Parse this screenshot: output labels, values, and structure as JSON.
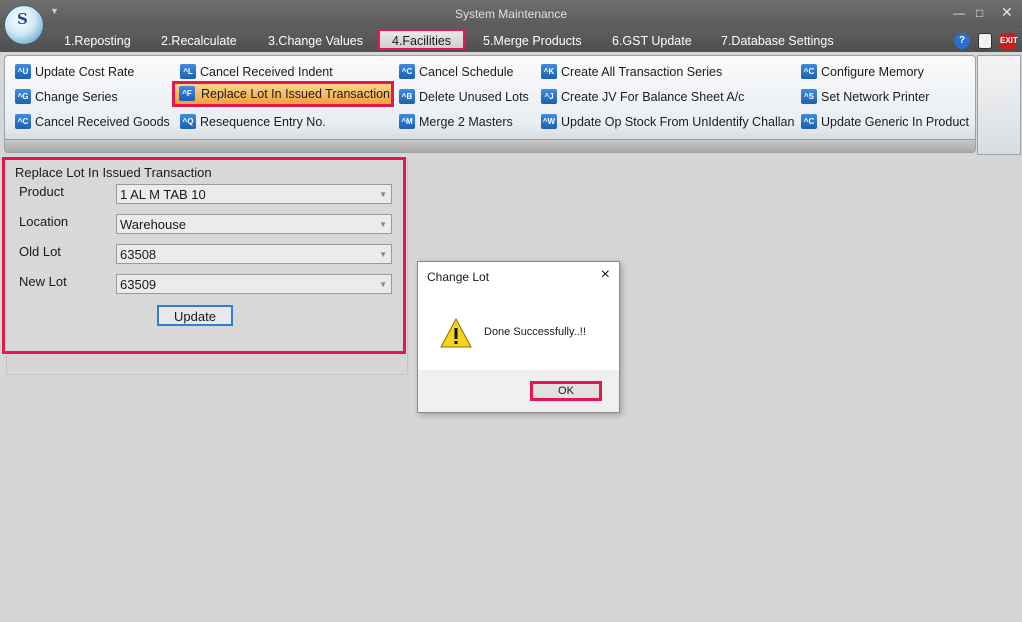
{
  "window": {
    "title": "System Maintenance"
  },
  "menu": {
    "items": [
      {
        "label": "1.Reposting"
      },
      {
        "label": "2.Recalculate"
      },
      {
        "label": "3.Change Values"
      },
      {
        "label": "4.Facilities"
      },
      {
        "label": "5.Merge Products"
      },
      {
        "label": "6.GST Update"
      },
      {
        "label": "7.Database Settings"
      }
    ],
    "active": "4.Facilities"
  },
  "ribbon": {
    "items": [
      {
        "label": "Update Cost Rate",
        "icon": "^U"
      },
      {
        "label": "Change Series",
        "icon": "^G"
      },
      {
        "label": "Cancel Received Goods",
        "icon": "^C"
      },
      {
        "label": "Cancel Received Indent",
        "icon": "^L"
      },
      {
        "label": "Replace Lot In Issued Transaction",
        "icon": "^F"
      },
      {
        "label": "Resequence Entry No.",
        "icon": "^Q"
      },
      {
        "label": "Cancel Schedule",
        "icon": "^C"
      },
      {
        "label": "Delete Unused Lots",
        "icon": "^B"
      },
      {
        "label": "Merge 2 Masters",
        "icon": "^M"
      },
      {
        "label": "Create All Transaction Series",
        "icon": "^K"
      },
      {
        "label": "Create JV For Balance Sheet A/c",
        "icon": "^J"
      },
      {
        "label": "Update Op Stock From UnIdentify Challan",
        "icon": "^W"
      },
      {
        "label": "Configure Memory",
        "icon": "^C"
      },
      {
        "label": "Set Network Printer",
        "icon": "^S"
      },
      {
        "label": "Update Generic In Product",
        "icon": "^C"
      }
    ]
  },
  "form": {
    "title": "Replace Lot In Issued Transaction",
    "fields": [
      {
        "label": "Product",
        "value": "1 AL M TAB 10"
      },
      {
        "label": "Location",
        "value": "Warehouse"
      },
      {
        "label": "Old Lot",
        "value": "63508"
      },
      {
        "label": "New Lot",
        "value": "63509"
      }
    ],
    "update_label": "Update"
  },
  "dialog": {
    "title": "Change Lot",
    "message": "Done Successfully..!!",
    "ok_label": "OK"
  },
  "icons": {
    "close": "×",
    "dropdown": "▼"
  },
  "colors": {
    "highlight": "#e6174f",
    "selected_item": "#f0a23a",
    "menubar": "#555555"
  }
}
